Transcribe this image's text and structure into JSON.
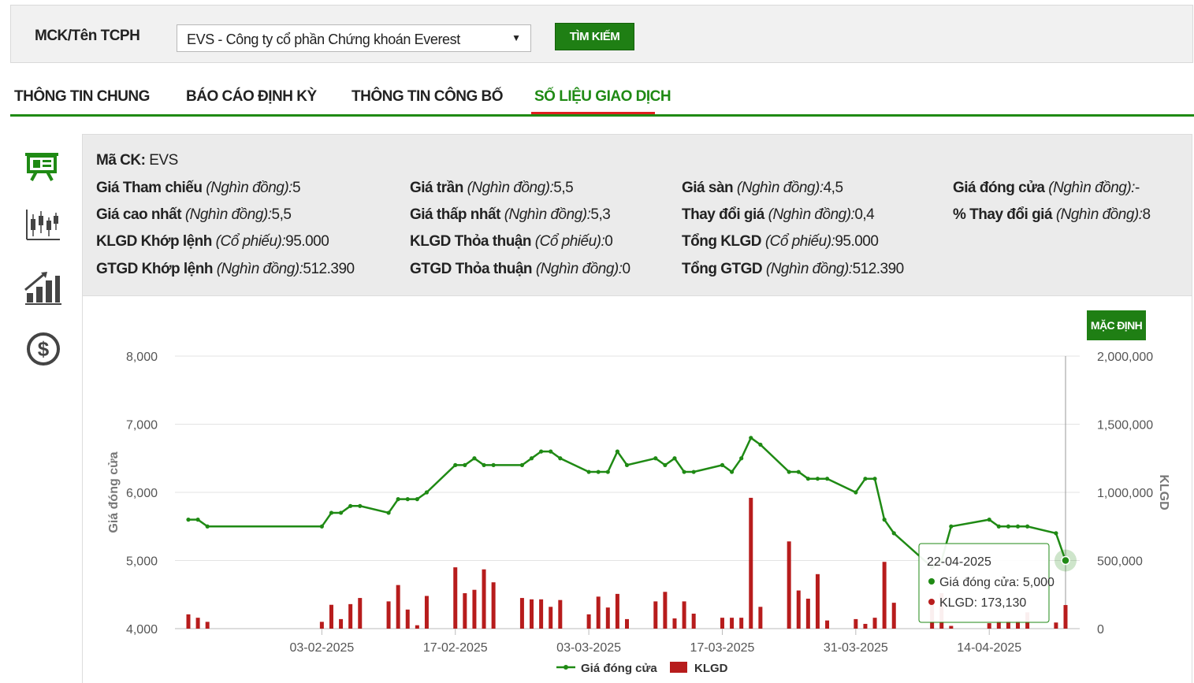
{
  "search": {
    "label": "MCK/Tên TCPH",
    "selected": "EVS - Công ty cổ phần Chứng khoán Everest",
    "button": "TÌM KIẾM"
  },
  "tabs": [
    {
      "label": "THÔNG TIN CHUNG",
      "active": false
    },
    {
      "label": "BÁO CÁO ĐỊNH KỲ",
      "active": false
    },
    {
      "label": "THÔNG TIN CÔNG BỐ",
      "active": false
    },
    {
      "label": "SỐ LIỆU GIAO DỊCH",
      "active": true
    }
  ],
  "sidebar_icons": [
    "presentation-board-icon",
    "candlestick-chart-icon",
    "growth-chart-icon",
    "dollar-coin-icon"
  ],
  "info": {
    "ma_ck_label": "Mã CK:",
    "ma_ck_value": " EVS",
    "unit_price": "(Nghìn đồng):",
    "unit_volume": "(Cổ phiếu):",
    "gia_tham_chieu": {
      "label": "Giá Tham chiếu ",
      "value": "5"
    },
    "gia_tran": {
      "label": "Giá trần ",
      "value": "5,5"
    },
    "gia_san": {
      "label": "Giá sàn ",
      "value": "4,5"
    },
    "gia_dong_cua": {
      "label": "Giá đóng cửa ",
      "value": "-"
    },
    "gia_cao_nhat": {
      "label": "Giá cao nhất ",
      "value": "5,5"
    },
    "gia_thap_nhat": {
      "label": "Giá thấp nhất ",
      "value": "5,3"
    },
    "thay_doi_gia": {
      "label": "Thay đổi giá ",
      "value": "0,4"
    },
    "pct_thay_doi": {
      "label": "% Thay đổi giá ",
      "value": "8"
    },
    "klgd_khop": {
      "label": "KLGD Khớp lệnh ",
      "value": "95.000"
    },
    "klgd_thoa": {
      "label": "KLGD Thỏa thuận ",
      "value": "0"
    },
    "tong_klgd": {
      "label": "Tổng KLGD ",
      "value": "95.000"
    },
    "gtgd_khop": {
      "label": "GTGD Khớp lệnh ",
      "value": "512.390"
    },
    "gtgd_thoa": {
      "label": "GTGD Thỏa thuận ",
      "value": "0"
    },
    "tong_gtgd": {
      "label": "Tổng GTGD ",
      "value": "512.390"
    }
  },
  "chart_buttons": {
    "default": "MẶC ĐỊNH"
  },
  "colors": {
    "green": "#1f8a14",
    "red": "#b71c1c",
    "brand_button": "#1f7f14"
  },
  "chart_data": {
    "type": "line+bar",
    "x_tick_labels": [
      "03-02-2025",
      "17-02-2025",
      "03-03-2025",
      "17-03-2025",
      "31-03-2025",
      "14-04-2025"
    ],
    "x_tick_dates": [
      "2025-02-03",
      "2025-02-17",
      "2025-03-03",
      "2025-03-17",
      "2025-03-31",
      "2025-04-14"
    ],
    "ylabel_left": "Giá đóng cửa",
    "ylabel_right": "KLGD",
    "ylim_left": [
      4000,
      8000
    ],
    "ylim_right": [
      0,
      2000000
    ],
    "y_ticks_left": [
      "4,000",
      "5,000",
      "6,000",
      "7,000",
      "8,000"
    ],
    "y_ticks_right": [
      "0",
      "500,000",
      "1,000,000",
      "1,500,000",
      "2,000,000"
    ],
    "legend": [
      {
        "name": "Giá đóng cửa",
        "type": "line"
      },
      {
        "name": "KLGD",
        "type": "bar"
      }
    ],
    "legend_position": "bottom",
    "grid": true,
    "series": [
      {
        "name": "Giá đóng cửa",
        "points": [
          [
            "2025-01-20",
            5600
          ],
          [
            "2025-01-21",
            5600
          ],
          [
            "2025-01-22",
            5500
          ],
          [
            "2025-02-03",
            5500
          ],
          [
            "2025-02-04",
            5700
          ],
          [
            "2025-02-05",
            5700
          ],
          [
            "2025-02-06",
            5800
          ],
          [
            "2025-02-07",
            5800
          ],
          [
            "2025-02-10",
            5700
          ],
          [
            "2025-02-11",
            5900
          ],
          [
            "2025-02-12",
            5900
          ],
          [
            "2025-02-13",
            5900
          ],
          [
            "2025-02-14",
            6000
          ],
          [
            "2025-02-17",
            6400
          ],
          [
            "2025-02-18",
            6400
          ],
          [
            "2025-02-19",
            6500
          ],
          [
            "2025-02-20",
            6400
          ],
          [
            "2025-02-21",
            6400
          ],
          [
            "2025-02-24",
            6400
          ],
          [
            "2025-02-25",
            6500
          ],
          [
            "2025-02-26",
            6600
          ],
          [
            "2025-02-27",
            6600
          ],
          [
            "2025-02-28",
            6500
          ],
          [
            "2025-03-03",
            6300
          ],
          [
            "2025-03-04",
            6300
          ],
          [
            "2025-03-05",
            6300
          ],
          [
            "2025-03-06",
            6600
          ],
          [
            "2025-03-07",
            6400
          ],
          [
            "2025-03-10",
            6500
          ],
          [
            "2025-03-11",
            6400
          ],
          [
            "2025-03-12",
            6500
          ],
          [
            "2025-03-13",
            6300
          ],
          [
            "2025-03-14",
            6300
          ],
          [
            "2025-03-17",
            6400
          ],
          [
            "2025-03-18",
            6300
          ],
          [
            "2025-03-19",
            6500
          ],
          [
            "2025-03-20",
            6800
          ],
          [
            "2025-03-21",
            6700
          ],
          [
            "2025-03-24",
            6300
          ],
          [
            "2025-03-25",
            6300
          ],
          [
            "2025-03-26",
            6200
          ],
          [
            "2025-03-27",
            6200
          ],
          [
            "2025-03-28",
            6200
          ],
          [
            "2025-03-31",
            6000
          ],
          [
            "2025-04-01",
            6200
          ],
          [
            "2025-04-02",
            6200
          ],
          [
            "2025-04-03",
            5600
          ],
          [
            "2025-04-04",
            5400
          ],
          [
            "2025-04-08",
            4900
          ],
          [
            "2025-04-09",
            5000
          ],
          [
            "2025-04-10",
            5500
          ],
          [
            "2025-04-14",
            5600
          ],
          [
            "2025-04-15",
            5500
          ],
          [
            "2025-04-16",
            5500
          ],
          [
            "2025-04-17",
            5500
          ],
          [
            "2025-04-18",
            5500
          ],
          [
            "2025-04-21",
            5400
          ],
          [
            "2025-04-22",
            5000
          ]
        ]
      },
      {
        "name": "KLGD",
        "points": [
          [
            "2025-01-20",
            105000
          ],
          [
            "2025-01-21",
            80000
          ],
          [
            "2025-01-22",
            50000
          ],
          [
            "2025-02-03",
            50000
          ],
          [
            "2025-02-04",
            175000
          ],
          [
            "2025-02-05",
            70000
          ],
          [
            "2025-02-06",
            180000
          ],
          [
            "2025-02-07",
            225000
          ],
          [
            "2025-02-10",
            200000
          ],
          [
            "2025-02-11",
            320000
          ],
          [
            "2025-02-12",
            140000
          ],
          [
            "2025-02-13",
            25000
          ],
          [
            "2025-02-14",
            240000
          ],
          [
            "2025-02-17",
            450000
          ],
          [
            "2025-02-18",
            260000
          ],
          [
            "2025-02-19",
            285000
          ],
          [
            "2025-02-20",
            435000
          ],
          [
            "2025-02-21",
            340000
          ],
          [
            "2025-02-24",
            225000
          ],
          [
            "2025-02-25",
            215000
          ],
          [
            "2025-02-26",
            215000
          ],
          [
            "2025-02-27",
            160000
          ],
          [
            "2025-02-28",
            210000
          ],
          [
            "2025-03-03",
            105000
          ],
          [
            "2025-03-04",
            235000
          ],
          [
            "2025-03-05",
            155000
          ],
          [
            "2025-03-06",
            255000
          ],
          [
            "2025-03-07",
            70000
          ],
          [
            "2025-03-10",
            200000
          ],
          [
            "2025-03-11",
            270000
          ],
          [
            "2025-03-12",
            75000
          ],
          [
            "2025-03-13",
            200000
          ],
          [
            "2025-03-14",
            110000
          ],
          [
            "2025-03-17",
            80000
          ],
          [
            "2025-03-18",
            80000
          ],
          [
            "2025-03-19",
            80000
          ],
          [
            "2025-03-20",
            960000
          ],
          [
            "2025-03-21",
            160000
          ],
          [
            "2025-03-24",
            640000
          ],
          [
            "2025-03-25",
            280000
          ],
          [
            "2025-03-26",
            220000
          ],
          [
            "2025-03-27",
            400000
          ],
          [
            "2025-03-28",
            60000
          ],
          [
            "2025-03-31",
            70000
          ],
          [
            "2025-04-01",
            35000
          ],
          [
            "2025-04-02",
            80000
          ],
          [
            "2025-04-03",
            490000
          ],
          [
            "2025-04-04",
            190000
          ],
          [
            "2025-04-08",
            180000
          ],
          [
            "2025-04-09",
            260000
          ],
          [
            "2025-04-10",
            20000
          ],
          [
            "2025-04-14",
            40000
          ],
          [
            "2025-04-15",
            60000
          ],
          [
            "2025-04-16",
            60000
          ],
          [
            "2025-04-17",
            60000
          ],
          [
            "2025-04-18",
            120000
          ],
          [
            "2025-04-21",
            45000
          ],
          [
            "2025-04-22",
            173130
          ]
        ]
      }
    ],
    "tooltip": {
      "date": "22-04-2025",
      "price_label": "Giá đóng cửa: 5,000",
      "volume_label": "KLGD: 173,130"
    }
  }
}
